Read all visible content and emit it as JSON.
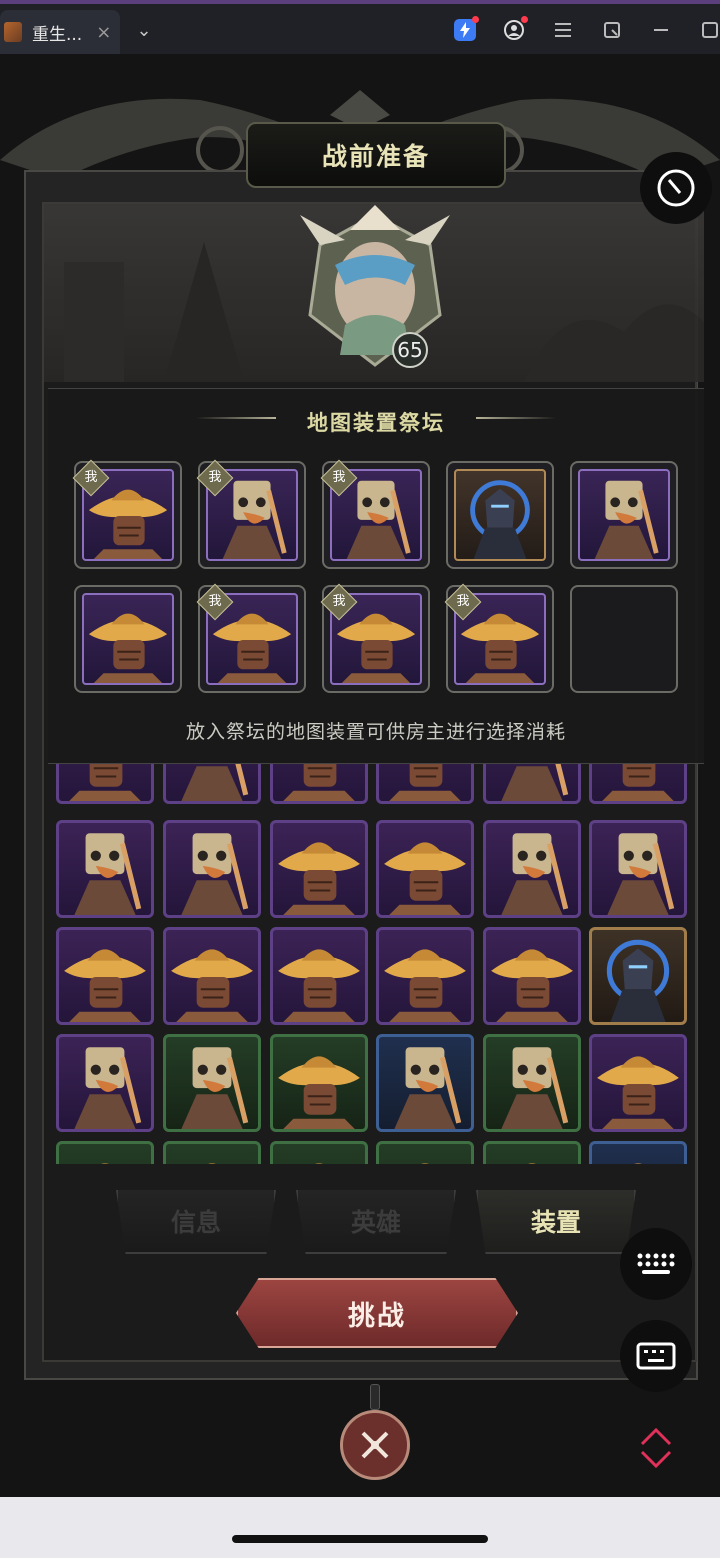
{
  "browser": {
    "tab_title": "重生...",
    "tab_close": "×",
    "tab_dropdown": "⌄"
  },
  "game": {
    "screen_title": "战前准备",
    "hero_level": "65",
    "altar": {
      "title": "地图装置祭坛",
      "owner_badge": "我",
      "hint": "放入祭坛的地图装置可供房主进行选择消耗",
      "slots": [
        {
          "item": "scarecrow-straw-hat",
          "mine": true,
          "frame": "purple"
        },
        {
          "item": "scarecrow-bucket-head",
          "mine": true,
          "frame": "purple"
        },
        {
          "item": "scarecrow-bucket-head",
          "mine": true,
          "frame": "purple"
        },
        {
          "item": "dark-knight",
          "mine": false,
          "frame": "gold"
        },
        {
          "item": "scarecrow-bucket-head",
          "mine": false,
          "frame": "purple"
        },
        {
          "item": "scarecrow-straw-hat",
          "mine": false,
          "frame": "purple"
        },
        {
          "item": "scarecrow-straw-hat",
          "mine": true,
          "frame": "purple"
        },
        {
          "item": "scarecrow-straw-hat",
          "mine": true,
          "frame": "purple"
        },
        {
          "item": "scarecrow-straw-hat",
          "mine": true,
          "frame": "purple"
        },
        {
          "item": "empty",
          "mine": false,
          "frame": "empty"
        }
      ]
    },
    "inventory": [
      [
        "purple",
        "straw"
      ],
      [
        "purple",
        "bucket"
      ],
      [
        "purple",
        "straw"
      ],
      [
        "purple",
        "straw"
      ],
      [
        "purple",
        "bucket"
      ],
      [
        "purple",
        "straw"
      ],
      [
        "purple",
        "bucket"
      ],
      [
        "purple",
        "bucket"
      ],
      [
        "purple",
        "straw"
      ],
      [
        "purple",
        "straw"
      ],
      [
        "purple",
        "bucket"
      ],
      [
        "purple",
        "bucket"
      ],
      [
        "purple",
        "straw"
      ],
      [
        "purple",
        "straw"
      ],
      [
        "purple",
        "straw"
      ],
      [
        "purple",
        "straw"
      ],
      [
        "purple",
        "straw"
      ],
      [
        "gold",
        "knight"
      ],
      [
        "purple",
        "bucket"
      ],
      [
        "green",
        "bucket"
      ],
      [
        "green",
        "straw"
      ],
      [
        "blue",
        "bucket"
      ],
      [
        "green",
        "bucket"
      ],
      [
        "purple",
        "straw"
      ],
      [
        "green",
        "straw"
      ],
      [
        "green",
        "straw"
      ],
      [
        "green",
        "straw"
      ],
      [
        "green",
        "straw"
      ],
      [
        "green",
        "straw"
      ],
      [
        "blue",
        "straw"
      ]
    ],
    "tabs": [
      "信息",
      "英雄",
      "装置"
    ],
    "active_tab": "装置",
    "challenge_label": "挑战"
  },
  "colors": {
    "accent_gold": "#e9e4b8",
    "challenge_red": "#9c4541",
    "frame_purple": "#5e4087"
  },
  "icons": [
    "lightning-icon",
    "account-icon",
    "menu-icon",
    "window-icon",
    "minimize-icon",
    "timer-icon",
    "keyboard-icon",
    "collapse-icon",
    "swords-icon"
  ]
}
